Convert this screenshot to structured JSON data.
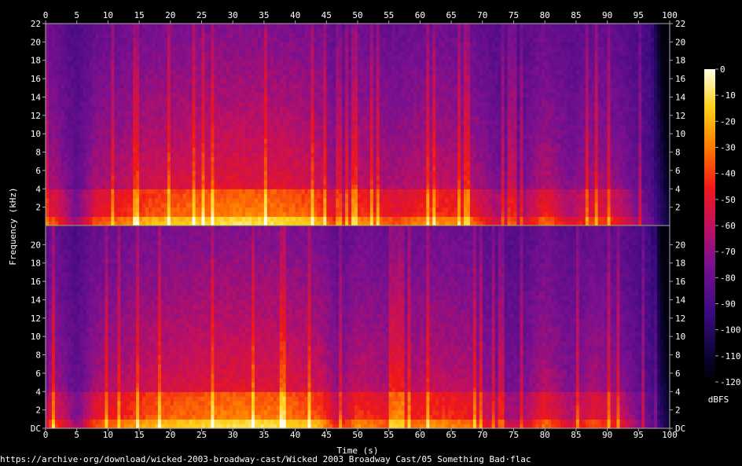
{
  "chart_data": {
    "type": "heatmap",
    "xlabel": "Time (s)",
    "ylabel": "Frequency (kHz)",
    "x_ticks": [
      0,
      5,
      10,
      15,
      20,
      25,
      30,
      35,
      40,
      45,
      50,
      55,
      60,
      65,
      70,
      75,
      80,
      85,
      90,
      95,
      100
    ],
    "xlim": [
      0,
      100
    ],
    "channels": 2,
    "y_ticks_top": [
      "2",
      "4",
      "6",
      "8",
      "10",
      "12",
      "14",
      "16",
      "18",
      "20",
      "22"
    ],
    "y_ticks_bottom": [
      "DC",
      "2",
      "4",
      "6",
      "8",
      "10",
      "12",
      "14",
      "16",
      "18",
      "20"
    ],
    "ylim_khz": [
      0,
      22
    ],
    "colorbar": {
      "label": "dBFS",
      "ticks": [
        0,
        -10,
        -20,
        -30,
        -40,
        -50,
        -60,
        -70,
        -80,
        -90,
        -100,
        -110,
        -120
      ],
      "range": [
        -120,
        0
      ]
    },
    "energy_profile": [
      {
        "t": 0,
        "level": 0.35
      },
      {
        "t": 1,
        "level": 0.6
      },
      {
        "t": 2,
        "level": 0.5
      },
      {
        "t": 5,
        "level": 0.25
      },
      {
        "t": 8,
        "level": 0.55
      },
      {
        "t": 12,
        "level": 0.6
      },
      {
        "t": 16,
        "level": 0.7
      },
      {
        "t": 22,
        "level": 0.75
      },
      {
        "t": 30,
        "level": 0.8
      },
      {
        "t": 38,
        "level": 0.78
      },
      {
        "t": 44,
        "level": 0.7
      },
      {
        "t": 47,
        "level": 0.45
      },
      {
        "t": 50,
        "level": 0.65
      },
      {
        "t": 56,
        "level": 0.55
      },
      {
        "t": 62,
        "level": 0.65
      },
      {
        "t": 68,
        "level": 0.6
      },
      {
        "t": 72,
        "level": 0.4
      },
      {
        "t": 76,
        "level": 0.35
      },
      {
        "t": 80,
        "level": 0.6
      },
      {
        "t": 84,
        "level": 0.4
      },
      {
        "t": 88,
        "level": 0.55
      },
      {
        "t": 92,
        "level": 0.45
      },
      {
        "t": 96,
        "level": 0.2
      },
      {
        "t": 100,
        "level": 0.05
      }
    ]
  },
  "footer": {
    "source_url": "https://archive·org/download/wicked-2003-broadway-cast/Wicked 2003 Broadway Cast/05 Something Bad·flac"
  }
}
